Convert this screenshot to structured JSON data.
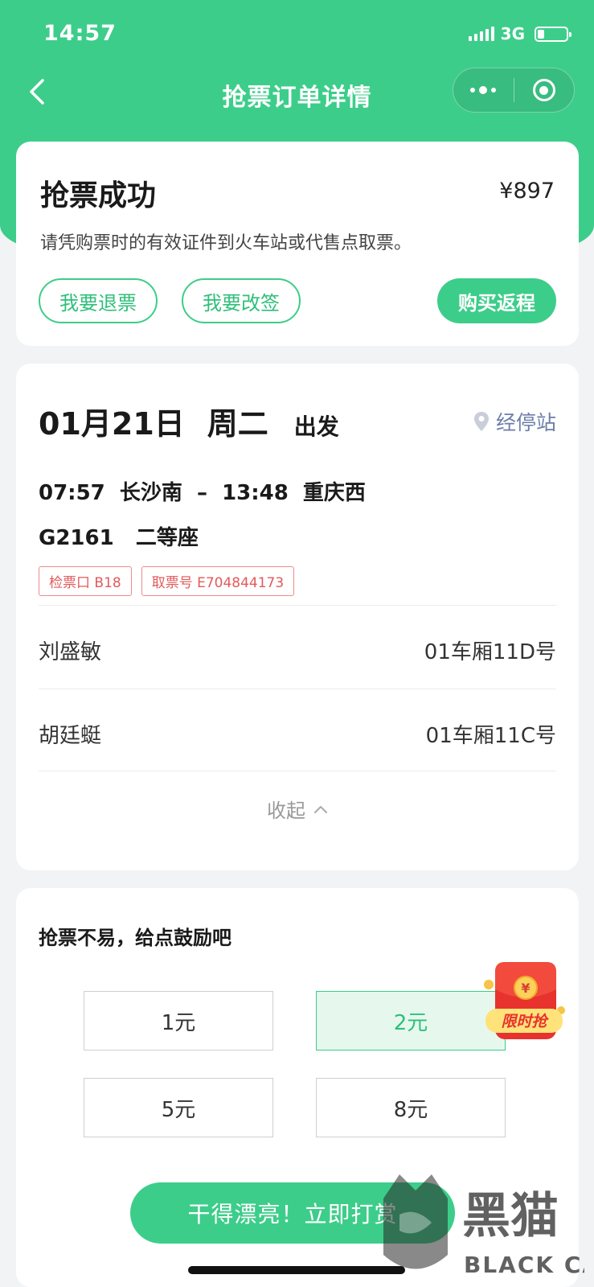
{
  "status_bar": {
    "time": "14:57",
    "network": "3G"
  },
  "nav": {
    "title": "抢票订单详情"
  },
  "order": {
    "status": "抢票成功",
    "price": "¥897",
    "note": "请凭购票时的有效证件到火车站或代售点取票。",
    "refund_label": "我要退票",
    "change_label": "我要改签",
    "return_label": "购买返程"
  },
  "trip": {
    "date": "01月21日",
    "weekday": "周二",
    "depart_label": "出发",
    "stops_label": "经停站",
    "route": "07:57  长沙南  –  13:48  重庆西",
    "train": "G2161   二等座",
    "tags": [
      "检票口 B18",
      "取票号 E704844173"
    ],
    "passengers": [
      {
        "name": "刘盛敏",
        "seat": "01车厢11D号"
      },
      {
        "name": "胡廷蜓",
        "seat": "01车厢11C号"
      }
    ],
    "collapse_label": "收起"
  },
  "reward": {
    "title": "抢票不易，给点鼓励吧",
    "amounts": [
      "1元",
      "2元",
      "5元",
      "8元"
    ],
    "selected": "2元",
    "promo_badge": "限时抢",
    "cta_label": "干得漂亮！立即打赏"
  },
  "watermark": {
    "text_cn": "黑猫",
    "text_en": "BLACK CAT"
  },
  "colors": {
    "brand_green": "#3dcd8a",
    "tag_red": "#e25a5a",
    "link_blue": "#6b7ea8"
  }
}
